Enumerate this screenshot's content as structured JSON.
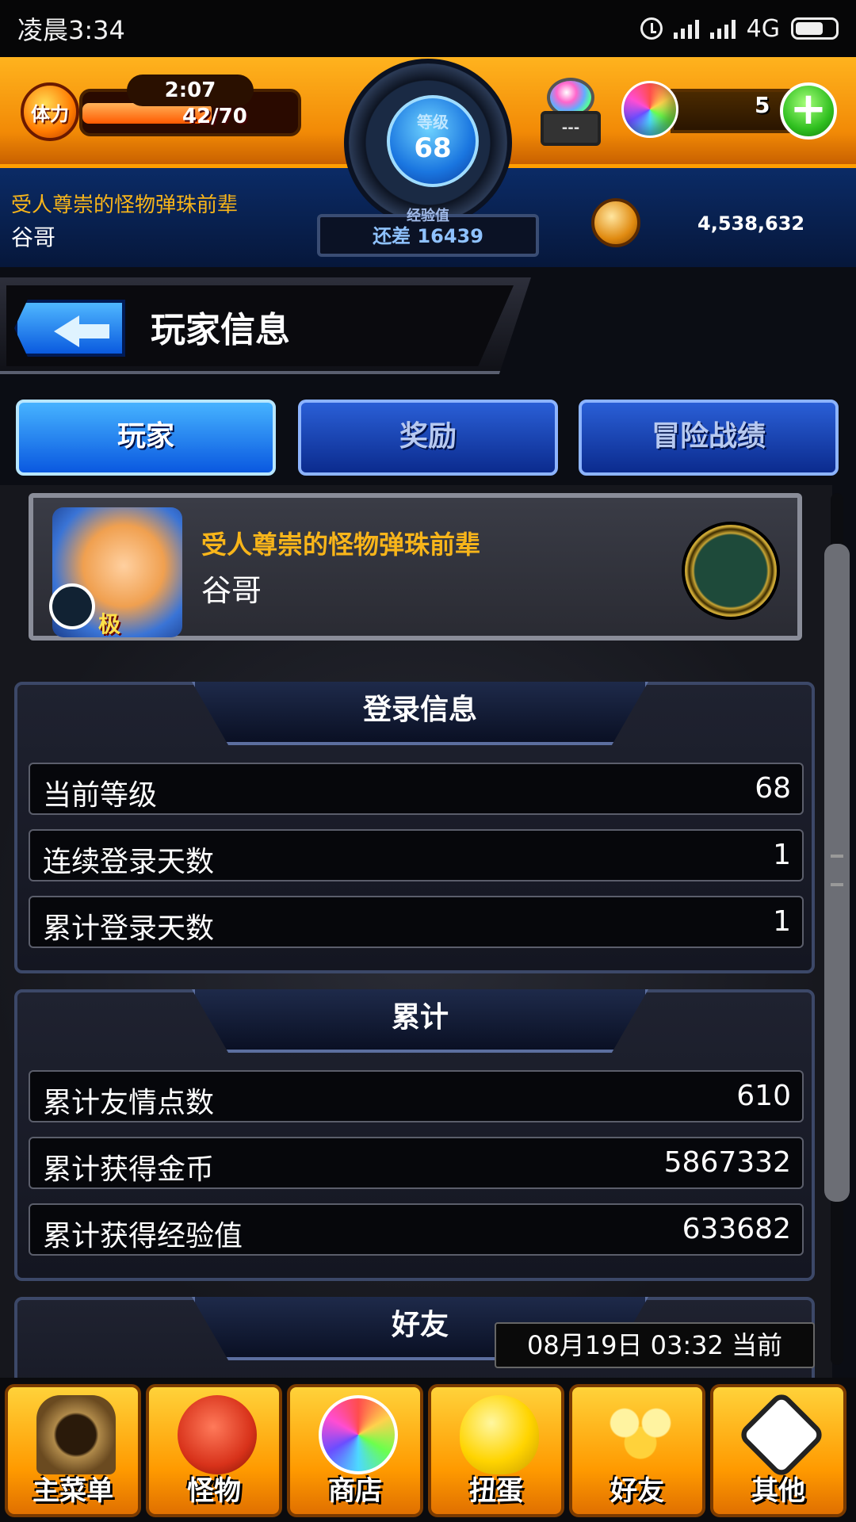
{
  "status_bar": {
    "time": "凌晨3:34",
    "network": "4G"
  },
  "header": {
    "stamina_label": "体力",
    "stamina_timer": "2:07",
    "stamina_count": "42/70",
    "stamina_fraction": 0.6,
    "level_label": "等级",
    "level_value": "68",
    "exp_label": "经验值",
    "exp_remaining": "还差 16439",
    "cart_label": "---",
    "orb_count": "5",
    "player_title": "受人尊崇的怪物弹珠前辈",
    "player_name": "谷哥",
    "coins": "4,538,632"
  },
  "page": {
    "title": "玩家信息"
  },
  "tabs": [
    {
      "label": "玩家",
      "active": true
    },
    {
      "label": "奖励",
      "active": false
    },
    {
      "label": "冒险战绩",
      "active": false
    }
  ],
  "profile": {
    "title": "受人尊崇的怪物弹珠前辈",
    "name": "谷哥",
    "badge": "极"
  },
  "sections": {
    "login": {
      "title": "登录信息",
      "rows": [
        {
          "label": "当前等级",
          "value": "68"
        },
        {
          "label": "连续登录天数",
          "value": "1"
        },
        {
          "label": "累计登录天数",
          "value": "1"
        }
      ]
    },
    "totals": {
      "title": "累计",
      "rows": [
        {
          "label": "累计友情点数",
          "value": "610"
        },
        {
          "label": "累计获得金币",
          "value": "5867332"
        },
        {
          "label": "累计获得经验值",
          "value": "633682"
        }
      ]
    },
    "friends": {
      "title": "好友"
    }
  },
  "toast": "08月19日 03:32 当前",
  "bottom_nav": [
    {
      "label": "主菜单",
      "icon": "home-gate-icon"
    },
    {
      "label": "怪物",
      "icon": "monster-icon"
    },
    {
      "label": "商店",
      "icon": "orb-shop-icon"
    },
    {
      "label": "扭蛋",
      "icon": "egg-gacha-icon"
    },
    {
      "label": "好友",
      "icon": "friends-icon"
    },
    {
      "label": "其他",
      "icon": "question-icon"
    }
  ],
  "colors": {
    "accent_orange": "#ff9a00",
    "gold_text": "#f8b51a",
    "tab_blue": "#0a58e0"
  }
}
